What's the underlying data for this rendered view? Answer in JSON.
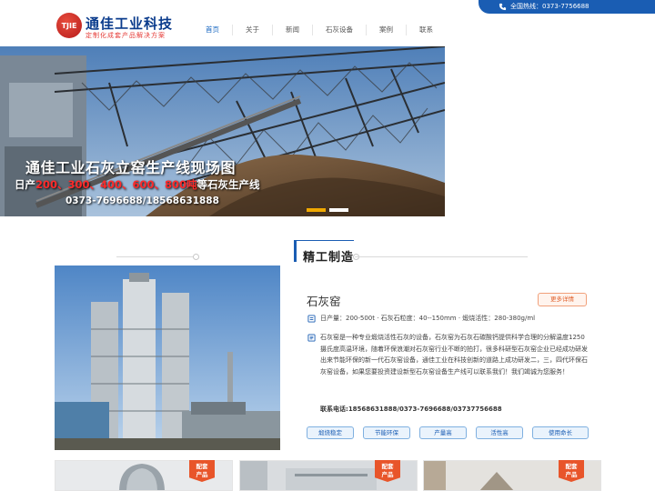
{
  "header": {
    "logo_text": "TJIE",
    "brand_name": "通佳工业科技",
    "brand_slogan": "定制化成套产品解决方案",
    "hotline": "全国热线：0373-7756688",
    "nav": [
      "首页",
      "关于",
      "新闻",
      "石灰设备",
      "案例",
      "联系"
    ],
    "active_nav": "首页"
  },
  "banner": {
    "title": "通佳工业石灰立窑生产线现场图",
    "sub_prefix": "日产",
    "sub_red": "200、300、400、600、800吨",
    "sub_suffix": "等石灰生产线",
    "phone": "0373-7696688/18568631888"
  },
  "section": {
    "title": "精工制造"
  },
  "product": {
    "name": "石灰窑",
    "more": "更多详情",
    "specs": "日产量：200-500t · 石灰石粒度：40--150mm · 煅烧活性：280-380g/ml",
    "description": "石灰窑是一种专业煅烧活性石灰的设备，石灰窑为石灰石碳酸钙提供科学合理的分解温度1250摄氏度高温环境，随着环保浪潮对石灰窑行业不断的拍打，很多科研型石灰窑企业已经成功研发出来节能环保的新一代石灰窑设备，通佳工业在科技创新的道路上成功研发二，三，四代环保石灰窑设备，如果您要投资建设新型石灰窑设备生产线可以联系我们！我们竭诚为您服务！",
    "contact_label": "联系电话:",
    "contact_value": "18568631888/0373-7696688/03737756688",
    "tags": [
      "煅烧稳定",
      "节能环保",
      "产量高",
      "活性高",
      "使用命长"
    ]
  },
  "cards": {
    "badge_line1": "配套",
    "badge_line2": "产品"
  },
  "colors": {
    "primary": "#1a5db3",
    "accent": "#e8552a",
    "banner_red": "#ff2a2a"
  }
}
